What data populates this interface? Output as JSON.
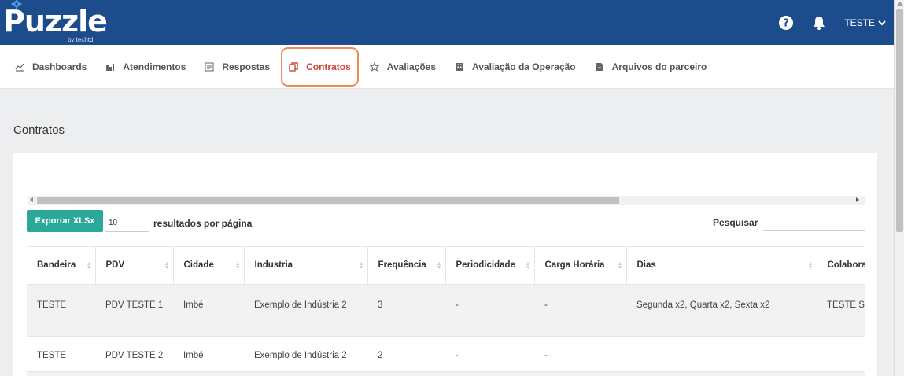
{
  "app": {
    "logo_text": "Puzzle",
    "logo_sub": "by techtd"
  },
  "header": {
    "user_label": "TESTE"
  },
  "nav": [
    {
      "label": "Dashboards",
      "icon": "chart-line-icon"
    },
    {
      "label": "Atendimentos",
      "icon": "bar-chart-icon"
    },
    {
      "label": "Respostas",
      "icon": "form-icon"
    },
    {
      "label": "Contratos",
      "icon": "copy-icon",
      "active": true
    },
    {
      "label": "Avaliações",
      "icon": "star-icon"
    },
    {
      "label": "Avaliação da Operação",
      "icon": "building-icon"
    },
    {
      "label": "Arquivos do parceiro",
      "icon": "pdf-file-icon"
    }
  ],
  "page_title": "Contratos",
  "controls": {
    "export_label": "Exportar XLSx",
    "page_size": "10",
    "page_size_label": "resultados por página",
    "search_label": "Pesquisar"
  },
  "table": {
    "headers": [
      "Bandeira",
      "PDV",
      "Cidade",
      "Industria",
      "Frequência",
      "Periodicidade",
      "Carga Horária",
      "Dias",
      "Colabora"
    ],
    "rows": [
      [
        "TESTE",
        "PDV TESTE 1",
        "Imbé",
        "Exemplo de Indústria 2",
        "3",
        "-",
        "-",
        "Segunda x2, Quarta x2, Sexta x2",
        "TESTE Sup. Sup"
      ],
      [
        "TESTE",
        "PDV TESTE 2",
        "Imbé",
        "Exemplo de Indústria 2",
        "2",
        "-",
        "-",
        "",
        ""
      ]
    ]
  },
  "colors": {
    "header_bg": "#1d4c8c",
    "accent": "#d0453a",
    "highlight_border": "#f08a52",
    "export_bg": "#2aa89a"
  }
}
